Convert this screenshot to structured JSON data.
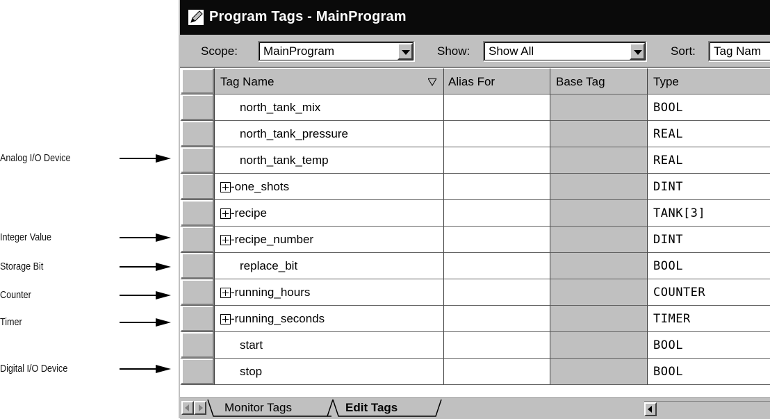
{
  "callouts": [
    {
      "label": "Analog I/O Device"
    },
    {
      "label": "Integer Value"
    },
    {
      "label": "Storage Bit"
    },
    {
      "label": "Counter"
    },
    {
      "label": "Timer"
    },
    {
      "label": "Digital I/O Device"
    }
  ],
  "window": {
    "title": "Program Tags - MainProgram",
    "icon": "pencil-icon"
  },
  "toolbar": {
    "scope_label": "Scope:",
    "scope_value": "MainProgram",
    "show_label": "Show:",
    "show_value": "Show All",
    "sort_label": "Sort:",
    "sort_value": "Tag Nam"
  },
  "columns": {
    "name": "Tag Name",
    "alias": "Alias For",
    "base": "Base Tag",
    "type": "Type"
  },
  "rows": [
    {
      "name": "north_tank_mix",
      "type": "BOOL"
    },
    {
      "name": "north_tank_pressure",
      "type": "REAL"
    },
    {
      "name": "north_tank_temp",
      "type": "REAL"
    },
    {
      "name": "-one_shots",
      "type": "DINT"
    },
    {
      "name": "-recipe",
      "type": "TANK[3]"
    },
    {
      "name": "-recipe_number",
      "type": "DINT"
    },
    {
      "name": "replace_bit",
      "type": "BOOL"
    },
    {
      "name": "-running_hours",
      "type": "COUNTER"
    },
    {
      "name": "-running_seconds",
      "type": "TIMER"
    },
    {
      "name": "start",
      "type": "BOOL"
    },
    {
      "name": "stop",
      "type": "BOOL"
    }
  ],
  "tabs": {
    "monitor": "Monitor Tags",
    "edit": "Edit Tags"
  }
}
